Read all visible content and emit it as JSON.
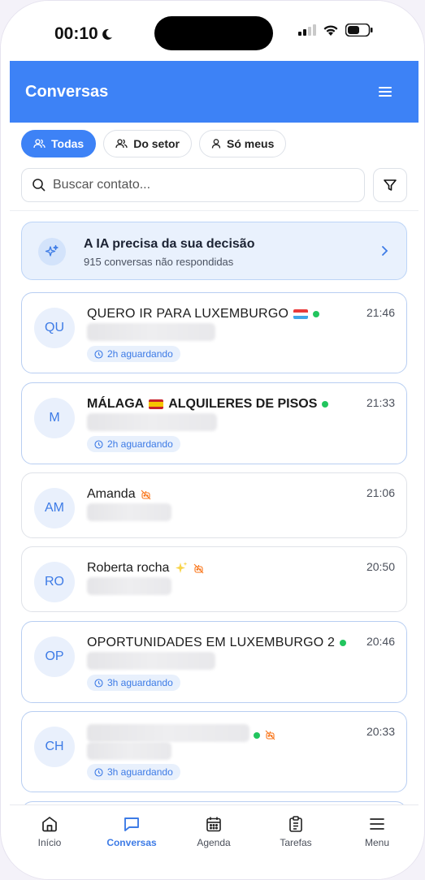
{
  "status": {
    "time": "00:10"
  },
  "header": {
    "title": "Conversas"
  },
  "filters": [
    {
      "label": "Todas",
      "active": true
    },
    {
      "label": "Do setor",
      "active": false
    },
    {
      "label": "Só meus",
      "active": false
    }
  ],
  "search": {
    "placeholder": "Buscar contato..."
  },
  "ai_banner": {
    "title": "A IA precisa da sua decisão",
    "subtitle": "915 conversas não respondidas"
  },
  "conversations": [
    {
      "initials": "QU",
      "name": "QUERO IR PARA LUXEMBURGO",
      "time": "21:46",
      "badge": "2h aguardando",
      "flag": "lu",
      "online": true
    },
    {
      "initials": "M",
      "name": "MÁLAGA",
      "name_suffix": "ALQUILERES DE PISOS",
      "time": "21:33",
      "badge": "2h aguardando",
      "flag": "es",
      "online": true
    },
    {
      "initials": "AM",
      "name": "Amanda",
      "time": "21:06",
      "bot_off": true
    },
    {
      "initials": "RO",
      "name": "Roberta rocha",
      "time": "20:50",
      "sparkles": true,
      "bot_off": true
    },
    {
      "initials": "OP",
      "name": "OPORTUNIDADES EM LUXEMBURGO 2",
      "time": "20:46",
      "badge": "3h aguardando",
      "online": true
    },
    {
      "initials": "CH",
      "name": "",
      "time": "20:33",
      "badge": "3h aguardando",
      "online": true,
      "bot_off": true
    }
  ],
  "bottom_nav": [
    {
      "label": "Início",
      "icon": "home-icon",
      "active": false
    },
    {
      "label": "Conversas",
      "icon": "chat-icon",
      "active": true
    },
    {
      "label": "Agenda",
      "icon": "calendar-icon",
      "active": false
    },
    {
      "label": "Tarefas",
      "icon": "clipboard-icon",
      "active": false
    },
    {
      "label": "Menu",
      "icon": "menu-icon",
      "active": false
    }
  ],
  "colors": {
    "primary": "#3d82f6",
    "online": "#22c55e",
    "bot_off": "#f97316"
  }
}
